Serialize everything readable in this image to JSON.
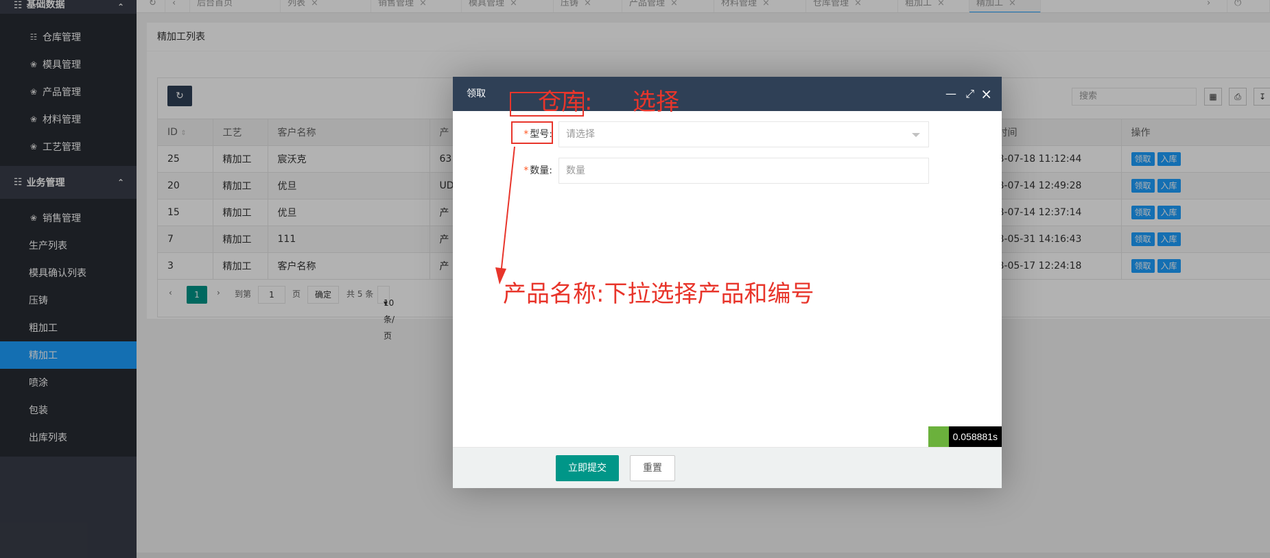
{
  "sidebar": {
    "groups": [
      {
        "label": "基础数据",
        "items": [
          {
            "label": "仓库管理",
            "icon": "database-icon"
          },
          {
            "label": "模具管理",
            "icon": "palette-icon"
          },
          {
            "label": "产品管理",
            "icon": "palette-icon"
          },
          {
            "label": "材料管理",
            "icon": "palette-icon"
          },
          {
            "label": "工艺管理",
            "icon": "palette-icon"
          }
        ]
      },
      {
        "label": "业务管理",
        "items": [
          {
            "label": "销售管理"
          },
          {
            "label": "生产列表"
          },
          {
            "label": "模具确认列表"
          },
          {
            "label": "压铸"
          },
          {
            "label": "粗加工"
          },
          {
            "label": "精加工",
            "active": true
          },
          {
            "label": "喷涂"
          },
          {
            "label": "包装"
          },
          {
            "label": "出库列表"
          }
        ]
      }
    ]
  },
  "tabs": [
    "后台首页",
    "列表",
    "销售管理",
    "模具管理",
    "压铸",
    "产品管理",
    "材料管理",
    "仓库管理",
    "粗加工",
    "精加工"
  ],
  "page": {
    "title": "精加工列表",
    "search_placeholder": "搜索",
    "columns": [
      "ID",
      "工艺",
      "客户名称",
      "产",
      "时间",
      "操作"
    ],
    "rows": [
      {
        "id": "25",
        "craft": "精加工",
        "customer": "宸沃克",
        "product": "63",
        "time": "8-07-18 11:12:44"
      },
      {
        "id": "20",
        "craft": "精加工",
        "customer": "优旦",
        "product": "UD",
        "time": "8-07-14 12:49:28"
      },
      {
        "id": "15",
        "craft": "精加工",
        "customer": "优旦",
        "product": "产",
        "time": "8-07-14 12:37:14"
      },
      {
        "id": "7",
        "craft": "精加工",
        "customer": "111",
        "product": "产",
        "time": "8-05-31 14:16:43"
      },
      {
        "id": "3",
        "craft": "精加工",
        "customer": "客户名称",
        "product": "产",
        "time": "8-05-17 12:24:18"
      }
    ],
    "row_actions": {
      "receive": "领取",
      "stock_in": "入库"
    },
    "pager": {
      "current": "1",
      "goto_label": "到第",
      "goto_value": "1",
      "page_unit": "页",
      "confirm": "确定",
      "total": "共 5 条",
      "page_size": "10 条/页"
    }
  },
  "modal": {
    "title": "领取",
    "fields": [
      {
        "label": "型号:",
        "placeholder": "请选择",
        "type": "select"
      },
      {
        "label": "数量:",
        "placeholder": "数量",
        "type": "input"
      }
    ],
    "submit": "立即提交",
    "reset": "重置",
    "timer": "0.058881s"
  },
  "annotations": {
    "top": "仓库:",
    "top_right": "选择",
    "middle": "产品名称:下拉选择产品和编号"
  }
}
